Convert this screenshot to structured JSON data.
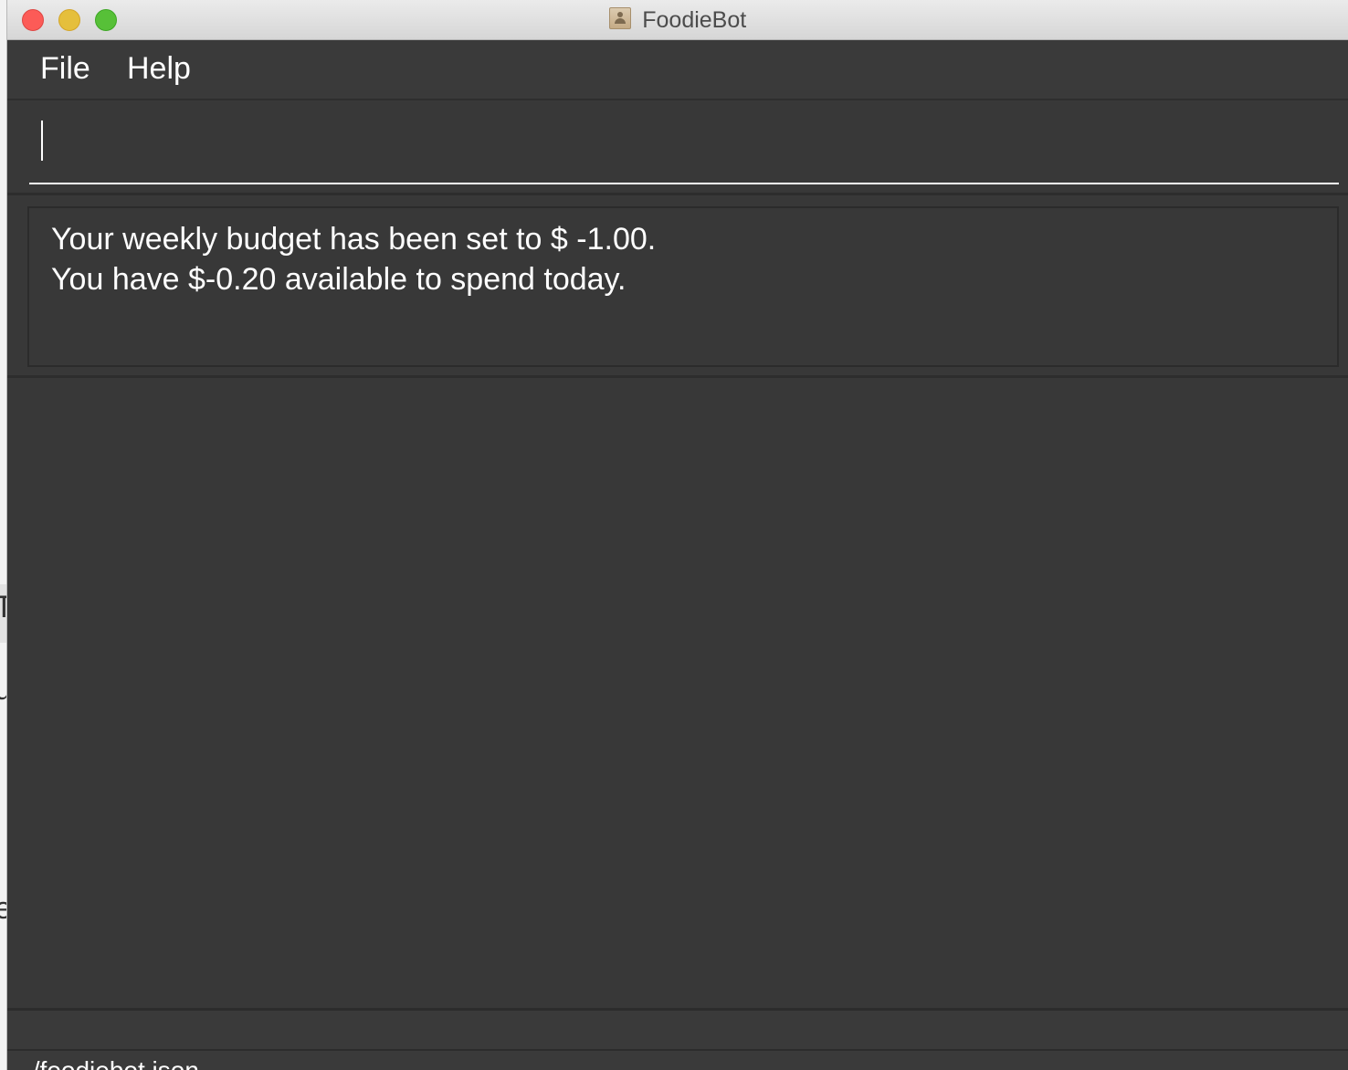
{
  "window": {
    "title": "FoodieBot"
  },
  "menu": {
    "items": [
      {
        "label": "File"
      },
      {
        "label": "Help"
      }
    ]
  },
  "command_box": {
    "value": "",
    "placeholder": ""
  },
  "result_display": {
    "lines": [
      "Your weekly budget has been set to $ -1.00.",
      "You have $-0.20 available to spend today."
    ]
  },
  "status_bar": {
    "save_location": "./foodiebot.json"
  },
  "colors": {
    "window_background": "#383838",
    "text": "#ffffff",
    "close_button": "#fc5b57",
    "minimize_button": "#e5bf3c",
    "maximize_button": "#57c038"
  }
}
